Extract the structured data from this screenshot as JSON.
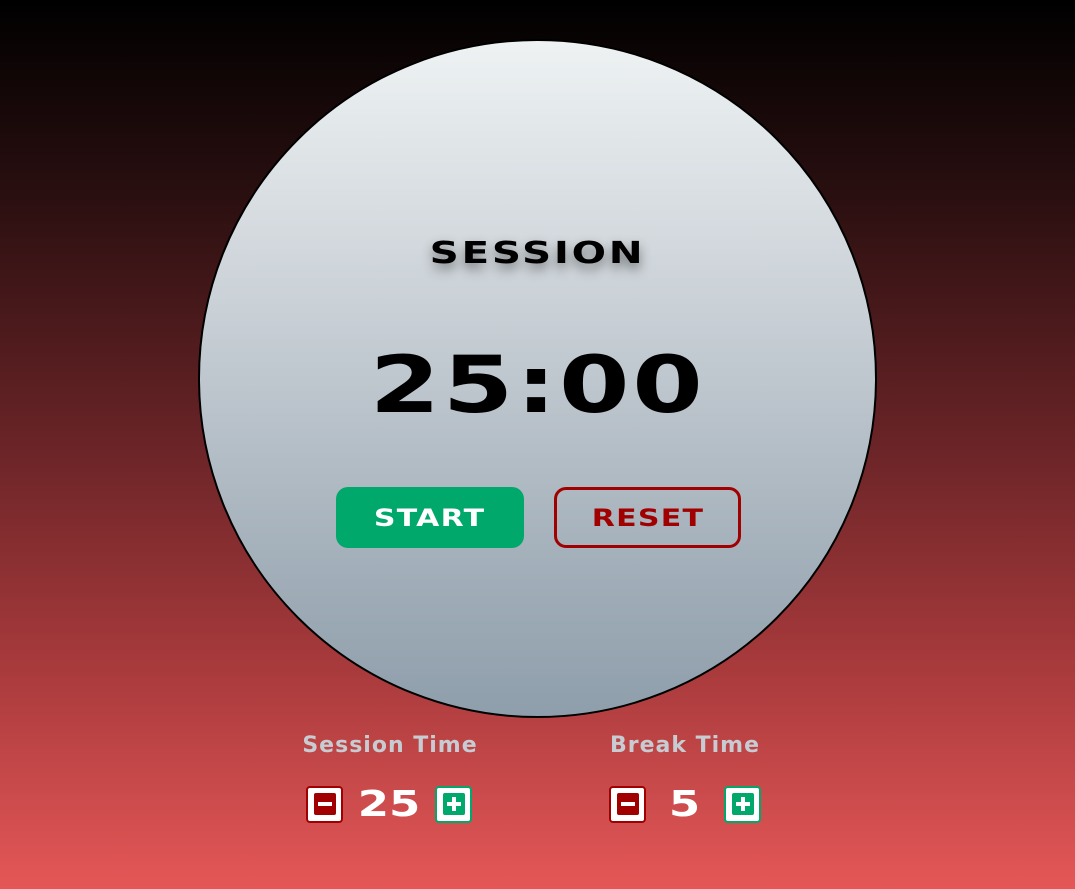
{
  "timer": {
    "mode_label": "SESSION",
    "time_display": "25:00",
    "start_label": "START",
    "reset_label": "RESET"
  },
  "controls": {
    "session": {
      "title": "Session Time",
      "value": "25"
    },
    "break": {
      "title": "Break Time",
      "value": "5"
    }
  },
  "icons": {
    "decrement": "minus-icon",
    "increment": "plus-icon"
  },
  "colors": {
    "start": "#00a86b",
    "reset": "#a10000",
    "decrement": "#a10000",
    "increment": "#00a86b"
  }
}
